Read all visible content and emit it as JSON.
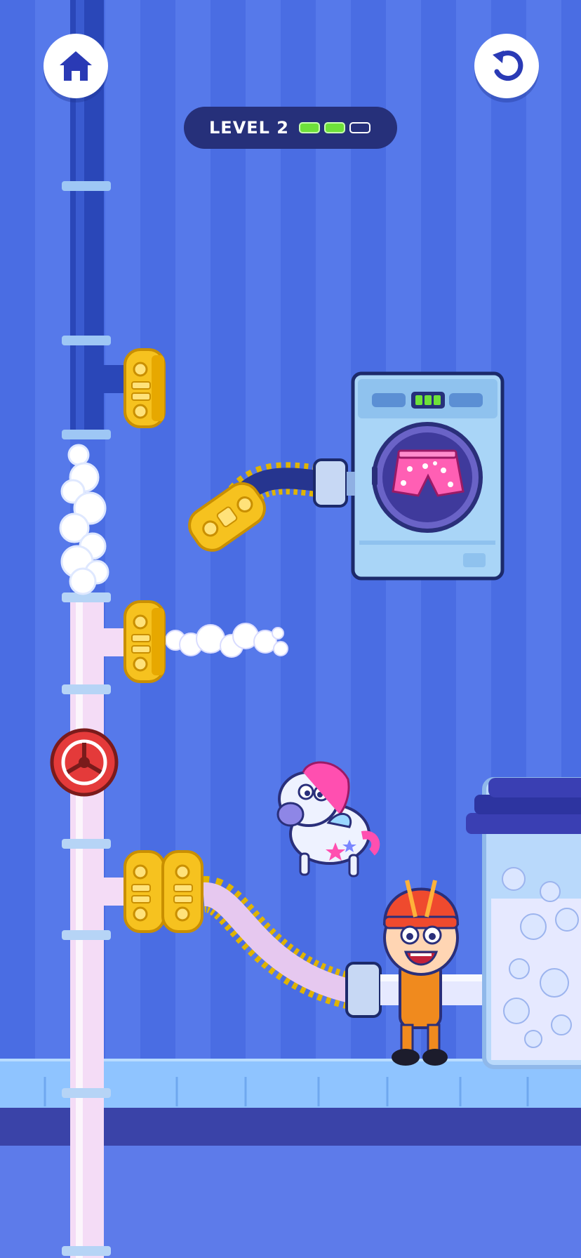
{
  "hud": {
    "home_icon": "home-icon",
    "restart_icon": "restart-icon",
    "level_label": "LEVEL 2",
    "level_progress": {
      "completed": 2,
      "total": 3
    }
  },
  "colors": {
    "background": "#4f72e6",
    "pipe_dark": "#2a47b8",
    "pipe_light": "#f4dcf6",
    "valve_gold": "#f6c21f",
    "shutoff_red": "#e43a3a",
    "washer_body": "#a9d5f7",
    "tank_water": "#e6e9ff",
    "progress_green": "#6ee13a"
  },
  "scene": {
    "washing_machine": {
      "indicator_lights": 3,
      "drum_item": "polka-dot-shorts"
    },
    "characters": [
      "plumber-boy",
      "unicorn"
    ],
    "effects": [
      "steam-cloud",
      "water-spray",
      "bubbles"
    ]
  }
}
